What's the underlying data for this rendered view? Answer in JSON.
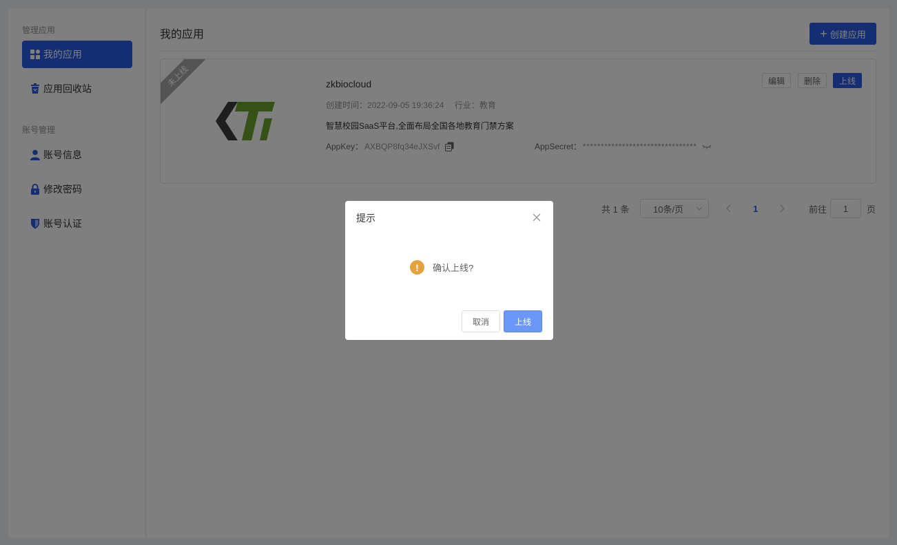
{
  "sidebar": {
    "group1_title": "管理应用",
    "group2_title": "账号管理",
    "items": [
      {
        "label": "我的应用",
        "icon": "apps-grid-icon",
        "active": true
      },
      {
        "label": "应用回收站",
        "icon": "recycle-bin-icon",
        "active": false
      },
      {
        "label": "账号信息",
        "icon": "user-icon",
        "active": false
      },
      {
        "label": "修改密码",
        "icon": "lock-icon",
        "active": false
      },
      {
        "label": "账号认证",
        "icon": "shield-icon",
        "active": false
      }
    ]
  },
  "main": {
    "title": "我的应用",
    "create_button": "创建应用"
  },
  "app_card": {
    "ribbon": "未上线",
    "name": "zkbiocloud",
    "created_label": "创建时间：",
    "created_value": "2022-09-05 19:36:24",
    "industry_label": "行业：",
    "industry_value": "教育",
    "description": "智慧校园SaaS平台,全面布局全国各地教育门禁方案",
    "appkey_label": "AppKey：",
    "appkey_value": "AXBQP8fq34eJXSvf",
    "appsecret_label": "AppSecret：",
    "appsecret_value": "********************************",
    "buttons": {
      "edit": "编辑",
      "delete": "删除",
      "online": "上线"
    }
  },
  "pagination": {
    "total": "共 1 条",
    "page_size": "10条/页",
    "current_page": "1",
    "goto_label": "前往",
    "goto_value": "1",
    "page_suffix": "页"
  },
  "dialog": {
    "title": "提示",
    "message": "确认上线?",
    "cancel": "取消",
    "confirm": "上线"
  },
  "colors": {
    "primary": "#2b5ce6",
    "warning": "#e6a23c",
    "logo_dark": "#3c3c3c",
    "logo_green": "#6aa52c"
  }
}
